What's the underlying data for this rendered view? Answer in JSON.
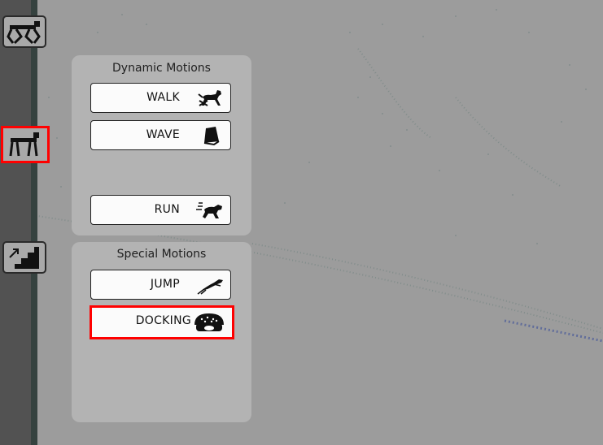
{
  "colors": {
    "highlight": "#ff0000",
    "panel": "#b3b3b3",
    "button": "#fbfbfb"
  },
  "sidebar": {
    "items": [
      {
        "name": "robot-standing",
        "icon": "robot-dog-icon",
        "active": false
      },
      {
        "name": "robot-walking",
        "icon": "robot-dog-walk-icon",
        "active": true
      },
      {
        "name": "stairs",
        "icon": "stairs-icon",
        "active": false
      }
    ]
  },
  "dynamic_panel": {
    "title": "Dynamic Motions",
    "buttons": [
      {
        "label": "WALK",
        "icon": "walking-dog-icon"
      },
      {
        "label": "WAVE",
        "icon": "wave-block-icon"
      },
      {
        "label": "RUN",
        "icon": "running-dog-icon"
      }
    ]
  },
  "special_panel": {
    "title": "Special Motions",
    "buttons": [
      {
        "label": "JUMP",
        "icon": "jumping-dog-icon",
        "selected": false
      },
      {
        "label": "DOCKING",
        "icon": "dog-bed-icon",
        "selected": true
      }
    ]
  }
}
